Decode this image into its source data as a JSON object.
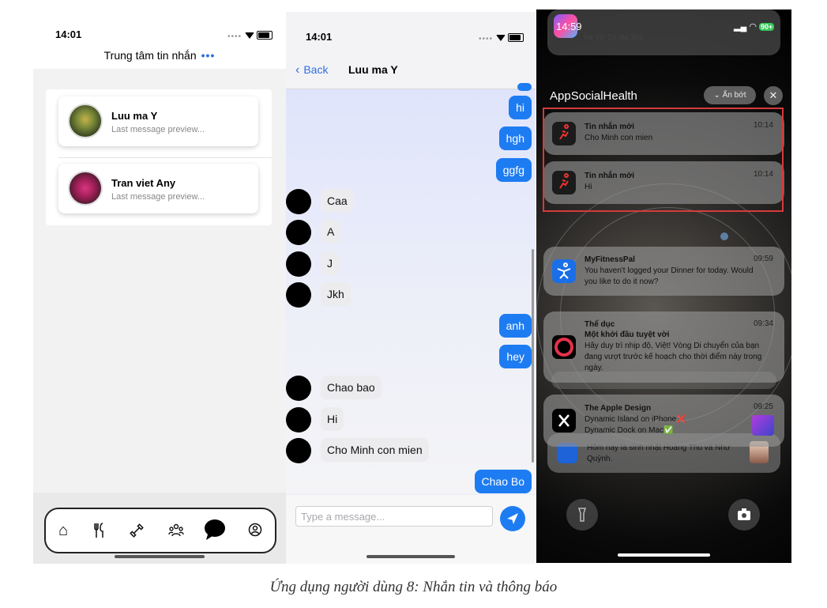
{
  "panel1": {
    "status": {
      "time": "14:01"
    },
    "header": {
      "title": "Trung tâm tin nhắn",
      "more": "•••"
    },
    "chats": [
      {
        "name": "Luu ma Y",
        "preview": "Last message preview..."
      },
      {
        "name": "Tran viet Any",
        "preview": "Last message preview..."
      }
    ],
    "tabs": [
      {
        "icon": "home-icon",
        "glyph": "⌂"
      },
      {
        "icon": "fork-knife-icon",
        "glyph": "ᵠ"
      },
      {
        "icon": "dumbbell-icon",
        "glyph": "⚲"
      },
      {
        "icon": "group-icon",
        "glyph": "♣"
      },
      {
        "icon": "chat-bubble-icon",
        "glyph": ""
      },
      {
        "icon": "profile-icon",
        "glyph": "☺"
      }
    ]
  },
  "panel2": {
    "status": {
      "time": "14:01"
    },
    "nav": {
      "back": "Back",
      "contact": "Luu ma Y"
    },
    "messages": [
      {
        "dir": "out",
        "text": "hi"
      },
      {
        "dir": "out",
        "text": "hgh"
      },
      {
        "dir": "out",
        "text": "ggfg"
      },
      {
        "dir": "in",
        "text": "Caa"
      },
      {
        "dir": "in",
        "text": "A"
      },
      {
        "dir": "in",
        "text": "J"
      },
      {
        "dir": "in",
        "text": "Jkh"
      },
      {
        "dir": "out",
        "text": "anh"
      },
      {
        "dir": "out",
        "text": "hey"
      },
      {
        "dir": "in",
        "text": "Chao bao"
      },
      {
        "dir": "in",
        "text": "Hi"
      },
      {
        "dir": "in",
        "text": "Cho Minh con mien"
      },
      {
        "dir": "out",
        "text": "Chao Bo"
      }
    ],
    "composer": {
      "placeholder": "Type a message..."
    }
  },
  "panel3": {
    "status": {
      "time": "14:59",
      "battery": "90+"
    },
    "top_partial": {
      "line1": "Hà Vũ: Có qte 3tr3"
    },
    "group": {
      "app": "AppSocialHealth",
      "show_less": "Ẩn bớt",
      "close": "✕"
    },
    "app_notifs": [
      {
        "title": "Tin nhắn mới",
        "time": "10:14",
        "body": "Cho Minh con mien"
      },
      {
        "title": "Tin nhắn mới",
        "time": "10:14",
        "body": "Hi"
      }
    ],
    "other_notifs": [
      {
        "app": "MyFitnessPal",
        "time": "09:59",
        "body": "You haven't logged your Dinner for today. Would you like to do it now?"
      },
      {
        "app": "Thể dục",
        "subtitle": "Một khởi đầu tuyệt vời",
        "time": "09:34",
        "body": "Hãy duy trì nhịp độ, Việt! Vòng Di chuyển của bạn đang vượt trước kế hoạch cho thời điểm này trong ngày."
      },
      {
        "app": "The Apple Design",
        "time": "09:25",
        "line1": "Dynamic Island on iPhone❌",
        "line2": "Dynamic Dock on Mac✅"
      }
    ],
    "bottom_partial": {
      "body": "Hôm nay là sinh nhật Hoàng Thu và Như Quỳnh."
    }
  },
  "caption": "Ứng dụng người dùng 8: Nhắn tin và thông báo",
  "colors": {
    "accent": "#1e7cf2",
    "highlight_border": "#d63a3a"
  }
}
